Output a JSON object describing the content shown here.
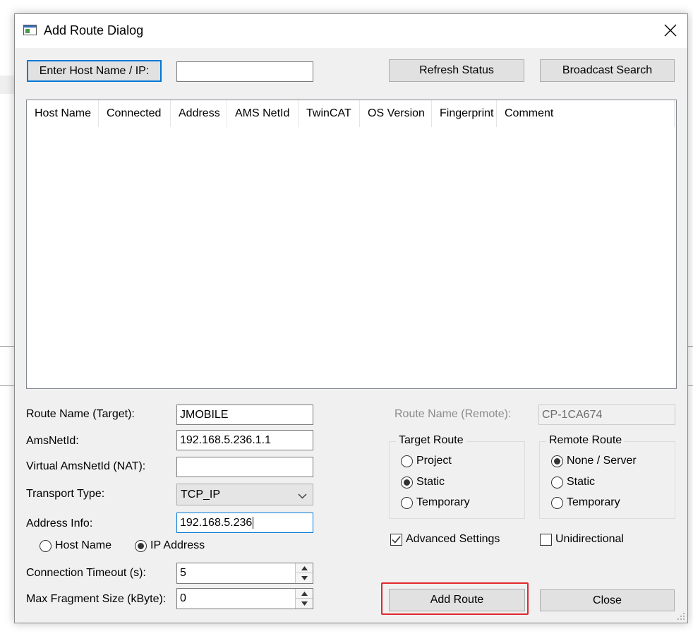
{
  "window": {
    "title": "Add Route Dialog"
  },
  "top": {
    "enter_host_label": "Enter Host Name / IP:",
    "host_value": "",
    "refresh_label": "Refresh Status",
    "broadcast_label": "Broadcast Search"
  },
  "list": {
    "columns": [
      "Host Name",
      "Connected",
      "Address",
      "AMS NetId",
      "TwinCAT",
      "OS Version",
      "Fingerprint",
      "Comment"
    ],
    "rows": []
  },
  "form": {
    "route_name_label": "Route Name (Target):",
    "route_name_value": "JMOBILE",
    "amsnetid_label": "AmsNetId:",
    "amsnetid_value": "192.168.5.236.1.1",
    "virtual_label": "Virtual AmsNetId (NAT):",
    "virtual_value": "",
    "transport_label": "Transport Type:",
    "transport_value": "TCP_IP",
    "address_info_label": "Address Info:",
    "address_info_value": "192.168.5.236",
    "addr_host_name": "Host Name",
    "addr_ip_address": "IP Address",
    "addr_selected": "IP Address",
    "timeout_label": "Connection Timeout (s):",
    "timeout_value": "5",
    "fragment_label": "Max Fragment Size (kByte):",
    "fragment_value": "0"
  },
  "right": {
    "remote_name_label": "Route Name (Remote):",
    "remote_name_value": "CP-1CA674",
    "target_route": {
      "title": "Target Route",
      "options": [
        "Project",
        "Static",
        "Temporary"
      ],
      "selected": "Static"
    },
    "remote_route": {
      "title": "Remote Route",
      "options": [
        "None / Server",
        "Static",
        "Temporary"
      ],
      "selected": "None / Server"
    },
    "advanced_label": "Advanced Settings",
    "advanced_checked": true,
    "unidirectional_label": "Unidirectional",
    "unidirectional_checked": false
  },
  "footer": {
    "add_route_label": "Add Route",
    "close_label": "Close"
  },
  "colors": {
    "focus_blue": "#0078d7",
    "highlight_red": "#e0282e",
    "dialog_bg": "#f0f0f0"
  },
  "icons": [
    "app-window-icon",
    "close-icon",
    "chevron-down-icon",
    "spin-up-icon",
    "spin-down-icon",
    "checkmark-icon",
    "resize-grip-icon"
  ]
}
